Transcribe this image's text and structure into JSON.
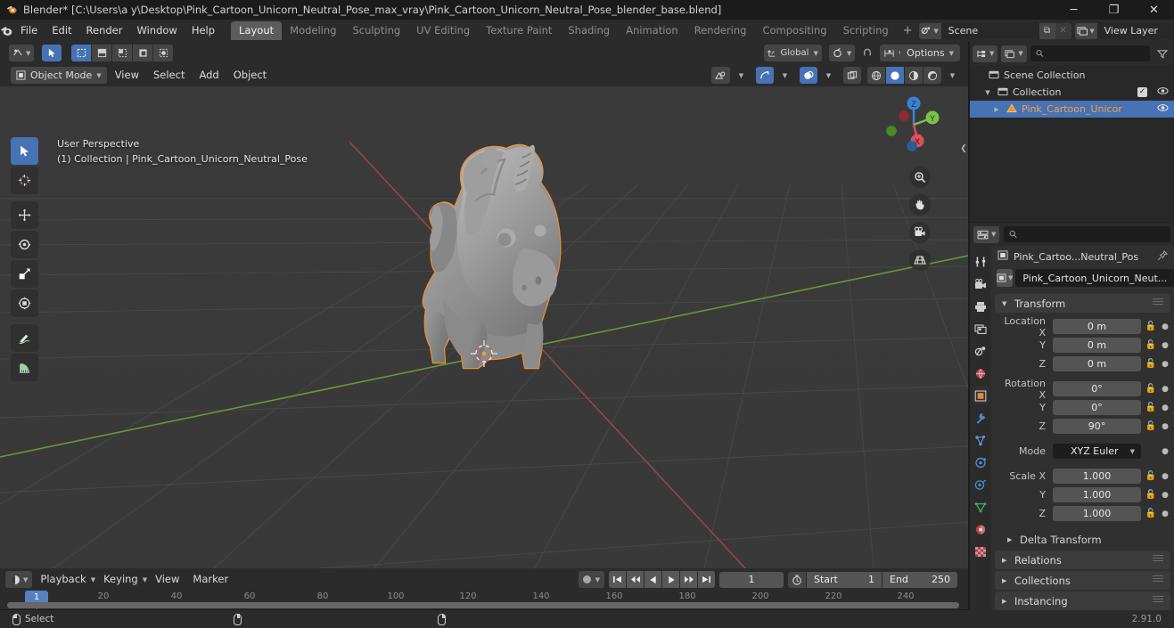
{
  "window": {
    "title": "Blender* [C:\\Users\\a y\\Desktop\\Pink_Cartoon_Unicorn_Neutral_Pose_max_vray\\Pink_Cartoon_Unicorn_Neutral_Pose_blender_base.blend]",
    "minimize": "─",
    "maximize": "❐",
    "close": "✕"
  },
  "topbar": {
    "menus": [
      "File",
      "Edit",
      "Render",
      "Window",
      "Help"
    ],
    "workspaces": [
      {
        "label": "Layout",
        "active": true
      },
      {
        "label": "Modeling",
        "active": false
      },
      {
        "label": "Sculpting",
        "active": false
      },
      {
        "label": "UV Editing",
        "active": false
      },
      {
        "label": "Texture Paint",
        "active": false
      },
      {
        "label": "Shading",
        "active": false
      },
      {
        "label": "Animation",
        "active": false
      },
      {
        "label": "Rendering",
        "active": false
      },
      {
        "label": "Compositing",
        "active": false
      },
      {
        "label": "Scripting",
        "active": false
      }
    ],
    "add_workspace": "+",
    "scene": {
      "name": "Scene",
      "new_label": "⧉",
      "remove_label": "✕"
    },
    "view_layer": {
      "name": "View Layer",
      "new_label": "⧉",
      "remove_label": "✕"
    }
  },
  "viewport": {
    "mode": "Object Mode",
    "menus": [
      "View",
      "Select",
      "Add",
      "Object"
    ],
    "transform_orientation": "Global",
    "options_label": "Options",
    "info_line1": "User Perspective",
    "info_line2": "(1) Collection | Pink_Cartoon_Unicorn_Neutral_Pose",
    "gizmo_axes": [
      "X",
      "Y",
      "Z"
    ],
    "tools": [
      {
        "name": "tweak-tool",
        "active": true
      },
      {
        "name": "cursor-tool",
        "active": false
      },
      {
        "name": "move-tool",
        "active": false
      },
      {
        "name": "rotate-tool",
        "active": false
      },
      {
        "name": "scale-tool",
        "active": false
      },
      {
        "name": "transform-tool",
        "active": false
      },
      {
        "name": "annotate-tool",
        "active": false
      },
      {
        "name": "measure-tool",
        "active": false
      }
    ],
    "nav_buttons": [
      "zoom-icon",
      "pan-hand-icon",
      "camera-icon",
      "grid-ortho-icon"
    ]
  },
  "outliner": {
    "search_placeholder": "",
    "rows": [
      {
        "label": "Scene Collection",
        "indent": 0,
        "arrow": "",
        "icon": "collection-icon",
        "checkbox": false,
        "eye": false,
        "selected": false
      },
      {
        "label": "Collection",
        "indent": 1,
        "arrow": "▼",
        "icon": "collection-icon",
        "checkbox": true,
        "eye": true,
        "selected": false
      },
      {
        "label": "Pink_Cartoon_Unicor",
        "indent": 2,
        "arrow": "▶",
        "icon": "mesh-object-icon",
        "checkbox": false,
        "eye": true,
        "selected": true
      }
    ]
  },
  "properties": {
    "search_placeholder": "",
    "breadcrumb_object": "Pink_Cartoo...Neutral_Pos",
    "object_name": "Pink_Cartoon_Unicorn_Neut...",
    "tabs": [
      {
        "name": "tool-tab",
        "active": false
      },
      {
        "name": "render-tab",
        "active": false
      },
      {
        "name": "output-tab",
        "active": false
      },
      {
        "name": "view-layer-tab",
        "active": false
      },
      {
        "name": "scene-tab",
        "active": false
      },
      {
        "name": "world-tab",
        "active": false
      },
      {
        "name": "object-tab",
        "active": true
      },
      {
        "name": "modifier-wrench-tab",
        "active": false
      },
      {
        "name": "particles-tab",
        "active": false
      },
      {
        "name": "physics-tab",
        "active": false
      },
      {
        "name": "constraints-tab",
        "active": false
      },
      {
        "name": "object-data-tab",
        "active": false
      },
      {
        "name": "material-tab",
        "active": false
      },
      {
        "name": "texture-tab",
        "active": false
      }
    ],
    "transform": {
      "title": "Transform",
      "rows": [
        {
          "label": "Location X",
          "value": "0 m"
        },
        {
          "label": "Y",
          "value": "0 m"
        },
        {
          "label": "Z",
          "value": "0 m"
        }
      ],
      "rotation": [
        {
          "label": "Rotation X",
          "value": "0°"
        },
        {
          "label": "Y",
          "value": "0°"
        },
        {
          "label": "Z",
          "value": "90°"
        }
      ],
      "mode_label": "Mode",
      "mode_value": "XYZ Euler",
      "scale": [
        {
          "label": "Scale X",
          "value": "1.000"
        },
        {
          "label": "Y",
          "value": "1.000"
        },
        {
          "label": "Z",
          "value": "1.000"
        }
      ],
      "delta_transform": "Delta Transform"
    },
    "panels": [
      "Relations",
      "Collections",
      "Instancing"
    ]
  },
  "timeline": {
    "menus": [
      "Playback",
      "Keying",
      "View",
      "Marker"
    ],
    "transport": [
      "⏮",
      "⏪",
      "◀",
      "▶",
      "⏩",
      "⏭"
    ],
    "current_frame": "1",
    "start_label": "Start",
    "start_value": "1",
    "end_label": "End",
    "end_value": "250",
    "ticks": [
      "20",
      "40",
      "60",
      "80",
      "100",
      "120",
      "140",
      "160",
      "180",
      "200",
      "220",
      "240"
    ],
    "playhead_frame": "1"
  },
  "statusbar": {
    "select_label": "Select",
    "version": "2.91.0"
  },
  "colors": {
    "accent_blue": "#4772b3",
    "selection_orange": "#f5a04a",
    "axis_x_red": "#e04e5c",
    "axis_y_green": "#7cc24a",
    "axis_z_blue": "#3b82d6",
    "viewport_bg": "#393939"
  }
}
